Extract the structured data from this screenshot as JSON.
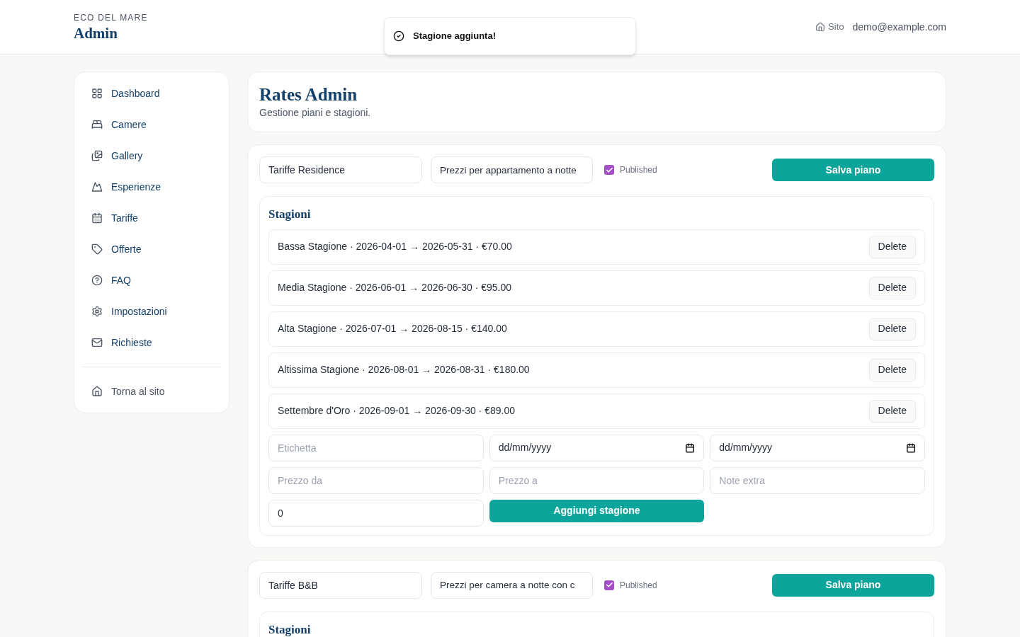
{
  "header": {
    "brand": "ECO DEL MARE",
    "title": "Admin",
    "site_link": "Sito",
    "user": "demo@example.com"
  },
  "toast": {
    "message": "Stagione aggiunta!"
  },
  "sidebar": {
    "items": [
      {
        "label": "Dashboard",
        "selected": false
      },
      {
        "label": "Camere",
        "selected": false
      },
      {
        "label": "Gallery",
        "selected": false
      },
      {
        "label": "Esperienze",
        "selected": false
      },
      {
        "label": "Tariffe",
        "selected": false
      },
      {
        "label": "Offerte",
        "selected": false
      },
      {
        "label": "FAQ",
        "selected": false
      },
      {
        "label": "Impostazioni",
        "selected": false
      },
      {
        "label": "Richieste",
        "selected": false
      }
    ],
    "footer_link": "Torna al sito"
  },
  "page": {
    "title": "Rates Admin",
    "subtitle": "Gestione piani e stagioni."
  },
  "plans": [
    {
      "name": "Tariffe Residence",
      "description": "Prezzi per appartamento a notte",
      "published": true,
      "published_label": "Published",
      "save_label": "Salva piano",
      "seasons_title": "Stagioni",
      "seasons": [
        {
          "text": "Bassa Stagione · 2026-04-01 → 2026-05-31 · €70.00",
          "delete_label": "Delete"
        },
        {
          "text": "Media Stagione · 2026-06-01 → 2026-06-30 · €95.00",
          "delete_label": "Delete"
        },
        {
          "text": "Alta Stagione · 2026-07-01 → 2026-08-15 · €140.00",
          "delete_label": "Delete"
        },
        {
          "text": "Altissima Stagione · 2026-08-01 → 2026-08-31 · €180.00",
          "delete_label": "Delete"
        },
        {
          "text": "Settembre d'Oro · 2026-09-01 → 2026-09-30 · €89.00",
          "delete_label": "Delete"
        }
      ],
      "new_season": {
        "fields": [
          {
            "kind": "text",
            "placeholder": "Etichetta"
          },
          {
            "kind": "date",
            "value": "dd/mm/yyyy"
          },
          {
            "kind": "date",
            "value": "dd/mm/yyyy"
          },
          {
            "kind": "text",
            "placeholder": "Prezzo da"
          },
          {
            "kind": "text",
            "placeholder": "Prezzo a"
          },
          {
            "kind": "text",
            "placeholder": "Note extra"
          },
          {
            "kind": "text",
            "value": "0"
          }
        ],
        "add_label": "Aggiungi stagione"
      }
    },
    {
      "name": "Tariffe B&B",
      "description": "Prezzi per camera a notte con c",
      "published": true,
      "published_label": "Published",
      "save_label": "Salva piano",
      "seasons_title": "Stagioni"
    }
  ]
}
